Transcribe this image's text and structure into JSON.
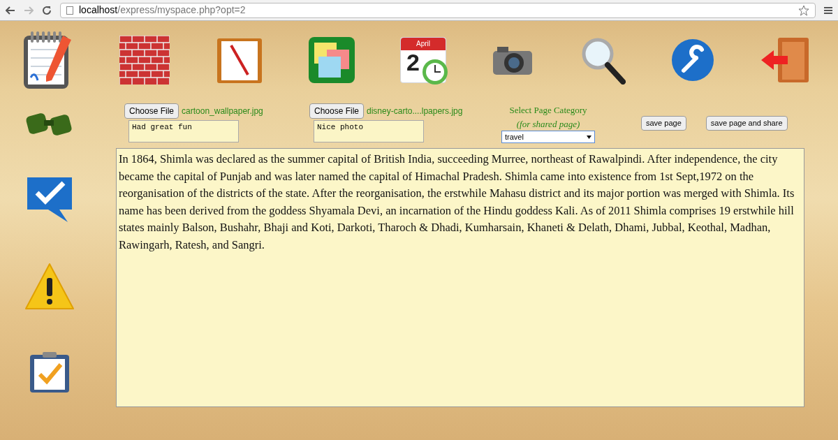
{
  "browser": {
    "url_host": "localhost",
    "url_path": "/express/myspace.php?opt=2"
  },
  "toolbar": {
    "calendar_month": "April",
    "calendar_day": "2"
  },
  "uploads": [
    {
      "button": "Choose File",
      "filename": "cartoon_wallpaper.jpg",
      "caption": "Had great fun"
    },
    {
      "button": "Choose File",
      "filename": "disney-carto....lpapers.jpg",
      "caption": "Nice photo"
    }
  ],
  "category": {
    "title": "Select Page Category",
    "subtitle": "(for shared page)",
    "value": "travel"
  },
  "buttons": [
    "save page",
    "save page and share"
  ],
  "editor": {
    "text": "In 1864, Shimla was declared as the summer capital of British India, succeeding Murree, northeast of Rawalpindi. After independence, the city became the capital of Punjab and was later named the capital of Himachal Pradesh. Shimla came into existence from 1st Sept,1972 on the reorganisation of the districts of the state. After the reorganisation, the erstwhile Mahasu district and its major portion was merged with Shimla. Its name has been derived from the goddess Shyamala Devi, an incarnation of the Hindu goddess Kali. As of 2011 Shimla comprises 19 erstwhile hill states mainly Balson, Bushahr, Bhaji and Koti, Darkoti, Tharoch & Dhadi, Kumharsain, Khaneti & Delath, Dhami, Jubbal, Keothal, Madhan, Rawingarh, Ratesh, and Sangri."
  }
}
